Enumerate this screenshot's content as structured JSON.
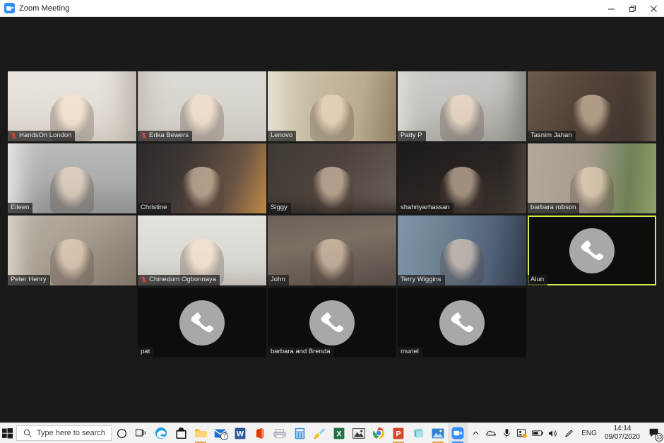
{
  "window": {
    "title": "Zoom Meeting",
    "app_icon": "zoom-video-icon",
    "minimize_label": "Minimize",
    "restore_label": "Restore",
    "close_label": "Close"
  },
  "meeting": {
    "layout": "gallery-view",
    "columns": 5,
    "rows": 4,
    "total_participants": 18,
    "active_speaker": "Alun",
    "active_border_color": "#d7e84c",
    "participants": [
      {
        "name": "HandsOn London",
        "video": true,
        "muted": true,
        "active": false,
        "row": 1,
        "col": 1,
        "scene": "woman-glasses-headset-white-wall"
      },
      {
        "name": "Erika Bewers",
        "video": true,
        "muted": true,
        "active": false,
        "row": 1,
        "col": 2,
        "scene": "woman-headphones-grey-wall"
      },
      {
        "name": "Lenovo",
        "video": true,
        "muted": false,
        "active": false,
        "row": 1,
        "col": 3,
        "scene": "older-woman-headset-kitchen"
      },
      {
        "name": "Patty P",
        "video": true,
        "muted": false,
        "active": false,
        "row": 1,
        "col": 4,
        "scene": "man-grey-sweater-lamp"
      },
      {
        "name": "Tasnim Jahan",
        "video": true,
        "muted": false,
        "active": false,
        "row": 1,
        "col": 5,
        "scene": "woman-dark-hair-bookshelf"
      },
      {
        "name": "Eileen",
        "video": true,
        "muted": false,
        "active": false,
        "row": 2,
        "col": 1,
        "scene": "woman-glasses-blinds"
      },
      {
        "name": "Christine",
        "video": true,
        "muted": false,
        "active": false,
        "row": 2,
        "col": 2,
        "scene": "woman-glasses-candle-lamp"
      },
      {
        "name": "Siggy",
        "video": true,
        "muted": false,
        "active": false,
        "row": 2,
        "col": 3,
        "scene": "woman-glasses-pictures-wall"
      },
      {
        "name": "shahriyarhassan",
        "video": true,
        "muted": false,
        "active": false,
        "row": 2,
        "col": 4,
        "scene": "man-beard-dark-room"
      },
      {
        "name": "barbara robson",
        "video": true,
        "muted": false,
        "active": false,
        "row": 2,
        "col": 5,
        "scene": "older-woman-window-garden"
      },
      {
        "name": "Peter Henry",
        "video": true,
        "muted": false,
        "active": false,
        "row": 3,
        "col": 1,
        "scene": "man-glasses-eiffel-picture"
      },
      {
        "name": "Chinedum Ogbonnaya",
        "video": true,
        "muted": true,
        "active": false,
        "row": 3,
        "col": 2,
        "scene": "man-headset-white-wall"
      },
      {
        "name": "John",
        "video": true,
        "muted": false,
        "active": false,
        "row": 3,
        "col": 3,
        "scene": "man-drinking-cup-portrait"
      },
      {
        "name": "Terry Wiggins",
        "video": true,
        "muted": false,
        "active": false,
        "row": 3,
        "col": 4,
        "scene": "older-man-reclining-bed"
      },
      {
        "name": "Alun",
        "video": false,
        "muted": false,
        "active": true,
        "row": 3,
        "col": 5,
        "scene": "phone-avatar"
      },
      {
        "name": "pat",
        "video": false,
        "muted": false,
        "active": false,
        "row": 4,
        "col": 2,
        "scene": "phone-avatar"
      },
      {
        "name": "barbara and Brenda",
        "video": false,
        "muted": false,
        "active": false,
        "row": 4,
        "col": 3,
        "scene": "phone-avatar"
      },
      {
        "name": "muriel",
        "video": false,
        "muted": false,
        "active": false,
        "row": 4,
        "col": 4,
        "scene": "phone-avatar"
      }
    ]
  },
  "taskbar": {
    "start_label": "Start",
    "search": {
      "placeholder": "Type here to search",
      "icon": "search-icon"
    },
    "cortana_label": "Cortana",
    "taskview_label": "Task View",
    "pinned": [
      {
        "name": "Microsoft Edge",
        "icon": "edge-icon",
        "running": false,
        "badge": ""
      },
      {
        "name": "Microsoft Store",
        "icon": "store-icon",
        "running": false,
        "badge": ""
      },
      {
        "name": "File Explorer",
        "icon": "folder-icon",
        "running": true,
        "badge": ""
      },
      {
        "name": "Mail",
        "icon": "mail-icon",
        "running": false,
        "badge": "7"
      },
      {
        "name": "Word",
        "icon": "word-icon",
        "running": false,
        "badge": ""
      },
      {
        "name": "Office",
        "icon": "office-icon",
        "running": false,
        "badge": ""
      },
      {
        "name": "Fax and Scan",
        "icon": "printer-icon",
        "running": false,
        "badge": ""
      },
      {
        "name": "Calculator",
        "icon": "calculator-icon",
        "running": false,
        "badge": ""
      },
      {
        "name": "Paint",
        "icon": "paint-icon",
        "running": false,
        "badge": ""
      },
      {
        "name": "Excel",
        "icon": "excel-icon",
        "running": false,
        "badge": ""
      },
      {
        "name": "Photos",
        "icon": "photos-icon",
        "running": false,
        "badge": ""
      },
      {
        "name": "Google Chrome",
        "icon": "chrome-icon",
        "running": false,
        "badge": ""
      },
      {
        "name": "PowerPoint",
        "icon": "powerpoint-icon",
        "running": true,
        "badge": ""
      },
      {
        "name": "Sticky Notes",
        "icon": "notes-icon",
        "running": false,
        "badge": ""
      },
      {
        "name": "Photo Viewer",
        "icon": "picture-icon",
        "running": true,
        "badge": ""
      },
      {
        "name": "Zoom",
        "icon": "zoom-icon",
        "running": true,
        "badge": ""
      }
    ],
    "tray": {
      "show_hidden_label": "Show hidden icons",
      "icons": [
        {
          "name": "OneDrive",
          "icon": "cloud-icon"
        },
        {
          "name": "Microphone",
          "icon": "microphone-icon"
        },
        {
          "name": "Updates",
          "icon": "update-badge-icon"
        },
        {
          "name": "Battery",
          "icon": "battery-icon"
        },
        {
          "name": "Volume",
          "icon": "speaker-icon"
        },
        {
          "name": "Pen menu",
          "icon": "pen-icon"
        }
      ],
      "language": "ENG",
      "time": "14:14",
      "date": "09/07/2020",
      "notifications": {
        "icon": "notification-icon",
        "count": "13"
      }
    }
  }
}
